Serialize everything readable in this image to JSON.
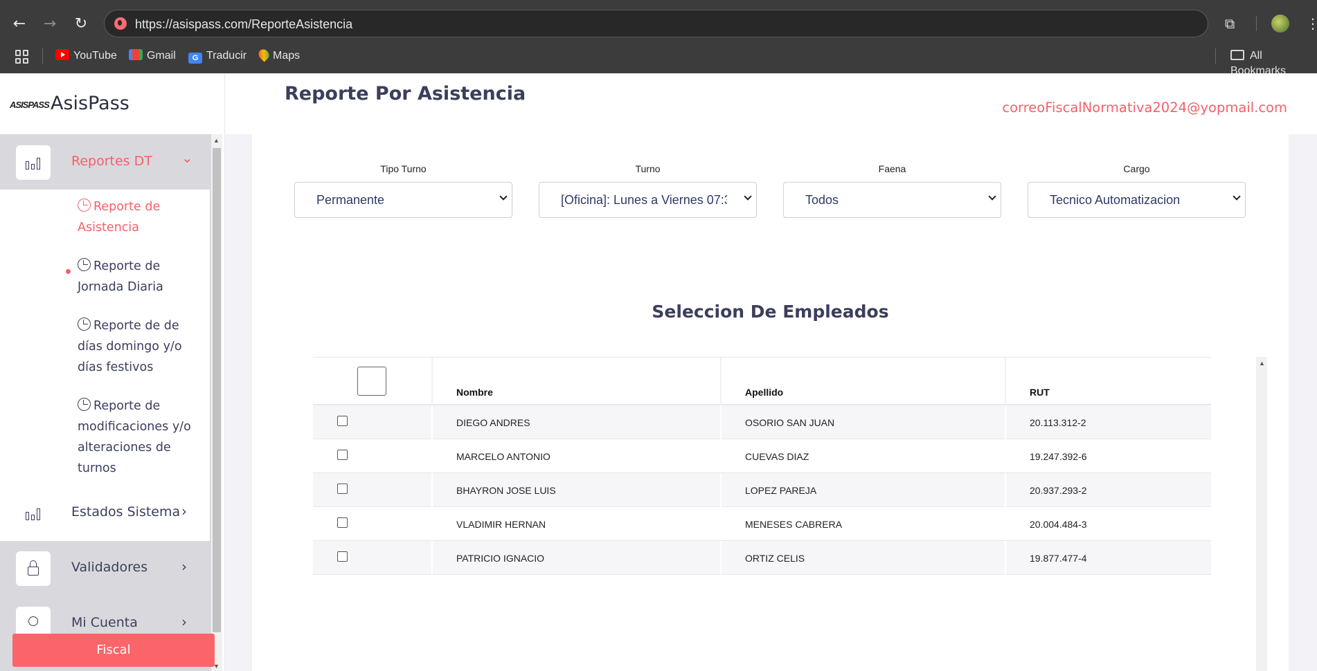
{
  "browser": {
    "url": "https://asispass.com/ReporteAsistencia",
    "bookmarks": [
      "YouTube",
      "Gmail",
      "Traducir",
      "Maps"
    ],
    "all_bookmarks": "All Bookmarks"
  },
  "app": {
    "logo_mark": "ASISPASS",
    "name": "AsisPass"
  },
  "sidebar": {
    "reportes": {
      "label": "Reportes DT",
      "chevron": "⌄"
    },
    "submenu": [
      {
        "label": "Reporte de Asistencia"
      },
      {
        "label": "Reporte de Jornada Diaria"
      },
      {
        "label": "Reporte de de días domingo y/o días festivos"
      },
      {
        "label": "Reporte de modificaciones y/o alteraciones de turnos"
      }
    ],
    "items": [
      {
        "label": "Estados Sistema",
        "chevron": "›"
      },
      {
        "label": "Validadores",
        "chevron": "›"
      },
      {
        "label": "Mi Cuenta",
        "chevron": "›"
      }
    ],
    "fiscal_button": "Fiscal"
  },
  "header": {
    "title": "Reporte Por Asistencia",
    "email": "correoFiscalNormativa2024@yopmail.com"
  },
  "filters": [
    {
      "label": "Tipo Turno",
      "value": "Permanente"
    },
    {
      "label": "Turno",
      "value": "[Oficina]: Lunes a Viernes 07:3"
    },
    {
      "label": "Faena",
      "value": "Todos"
    },
    {
      "label": "Cargo",
      "value": "Tecnico Automatizacion"
    }
  ],
  "employees": {
    "title": "Seleccion De Empleados",
    "columns": [
      "Nombre",
      "Apellido",
      "RUT"
    ],
    "rows": [
      {
        "nombre": "DIEGO ANDRES",
        "apellido": "OSORIO SAN JUAN",
        "rut": "20.113.312-2"
      },
      {
        "nombre": "MARCELO ANTONIO",
        "apellido": "CUEVAS DIAZ",
        "rut": "19.247.392-6"
      },
      {
        "nombre": "BHAYRON JOSE LUIS",
        "apellido": "LOPEZ PAREJA",
        "rut": "20.937.293-2"
      },
      {
        "nombre": "VLADIMIR HERNAN",
        "apellido": "MENESES CABRERA",
        "rut": "20.004.484-3"
      },
      {
        "nombre": "PATRICIO IGNACIO",
        "apellido": "ORTIZ CELIS",
        "rut": "19.877.477-4"
      }
    ]
  },
  "colors": {
    "accent": "#f5606a",
    "fiscal": "#fb6569",
    "text": "#3b3e5c"
  }
}
